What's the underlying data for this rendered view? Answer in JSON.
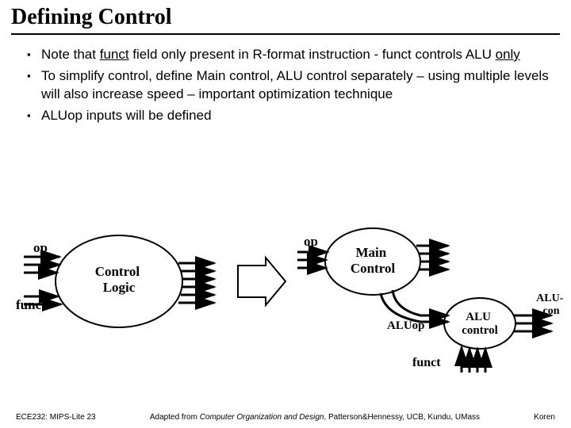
{
  "title": "Defining Control",
  "bullets": [
    {
      "pre": "Note that ",
      "u1": "funct",
      "mid": " field only present in R-format instruction - funct controls ALU ",
      "u2": "only",
      "post": ""
    },
    {
      "pre": "To simplify control, define Main control, ALU control separately – using multiple levels will also increase speed – important optimization technique",
      "u1": "",
      "mid": "",
      "u2": "",
      "post": ""
    },
    {
      "pre": "ALUop inputs will be defined",
      "u1": "",
      "mid": "",
      "u2": "",
      "post": ""
    }
  ],
  "diagram": {
    "left_input_top": "op",
    "left_input_bot": "funct",
    "left_block": "Control\nLogic",
    "right_input_top": "op",
    "right_block_main": "Main\nControl",
    "right_aluop": "ALUop",
    "right_alu_ctrl": "ALU\ncontrol",
    "right_output": "ALU-\ncon",
    "right_funct": "funct"
  },
  "footer": {
    "left": "ECE232: MIPS-Lite 23",
    "mid_pre": "Adapted from ",
    "mid_it": "Computer Organization and Design",
    "mid_post": ", Patterson&Hennessy, UCB, Kundu, UMass",
    "right": "Koren"
  }
}
